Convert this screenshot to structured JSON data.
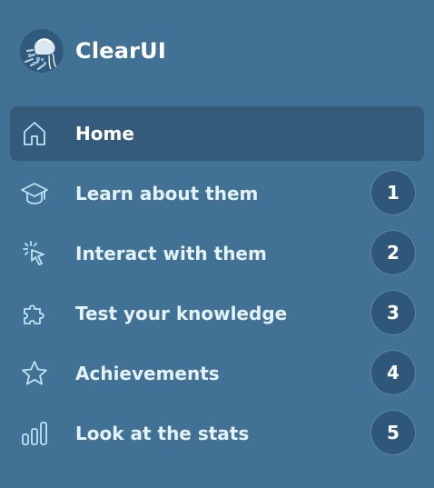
{
  "brand": {
    "name": "ClearUI",
    "logo_icon": "jellyfish-logo-icon"
  },
  "colors": {
    "background": "#427196",
    "active_item": "#345a7c",
    "badge": "#2e5779",
    "icon": "#bde4f7",
    "text": "#e4f3fb"
  },
  "nav": {
    "items": [
      {
        "label": "Home",
        "icon": "home-icon",
        "active": true
      },
      {
        "label": "Learn about them",
        "icon": "graduation-cap-icon",
        "badge": "1"
      },
      {
        "label": "Interact with them",
        "icon": "cursor-click-icon",
        "badge": "2"
      },
      {
        "label": "Test your knowledge",
        "icon": "puzzle-icon",
        "badge": "3"
      },
      {
        "label": "Achievements",
        "icon": "star-icon",
        "badge": "4"
      },
      {
        "label": "Look at the stats",
        "icon": "bar-chart-icon",
        "badge": "5"
      }
    ]
  }
}
